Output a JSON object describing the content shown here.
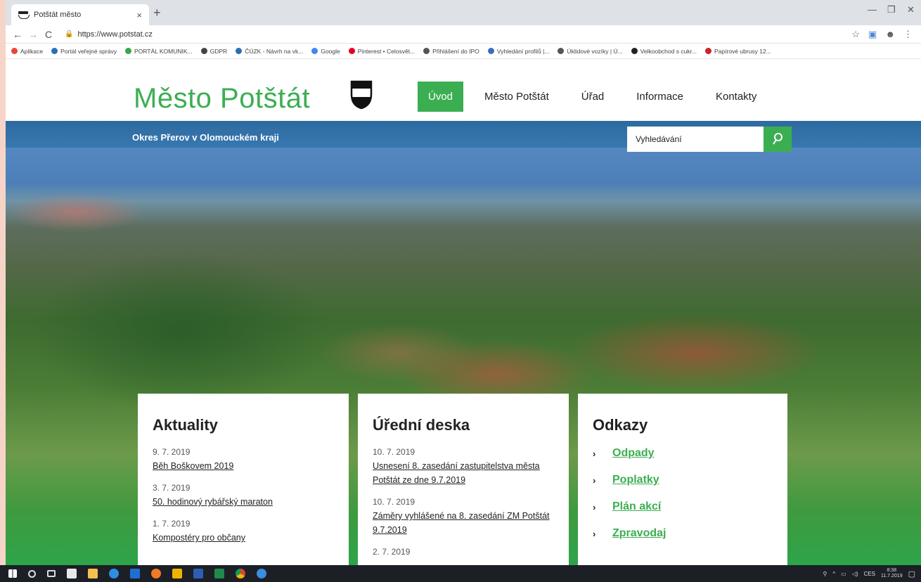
{
  "browser": {
    "tab_title": "Potštát město",
    "tab_close": "×",
    "new_tab": "+",
    "url": "https://www.potstat.cz",
    "bookmarks": [
      {
        "label": "Aplikace",
        "color": "#e5463a"
      },
      {
        "label": "Portál veřejné správy",
        "color": "#2a6fb5"
      },
      {
        "label": "PORTÁL KOMUNIK...",
        "color": "#3aa64c"
      },
      {
        "label": "GDPR",
        "color": "#444444"
      },
      {
        "label": "ČÚZK - Návrh na vk...",
        "color": "#2a6fb5"
      },
      {
        "label": "Google",
        "color": "#4285f4"
      },
      {
        "label": "Pinterest • Celosvět...",
        "color": "#e60023"
      },
      {
        "label": "Přihlášení do IPO",
        "color": "#555555"
      },
      {
        "label": "Vyhledání profilů |...",
        "color": "#3a6fc0"
      },
      {
        "label": "Úklidové vozíky | Ú...",
        "color": "#555555"
      },
      {
        "label": "Velkoobchod s cukr...",
        "color": "#222222"
      },
      {
        "label": "Papírové ubrusy 12...",
        "color": "#d0202a"
      }
    ]
  },
  "site": {
    "logo_text": "Město Potštát",
    "nav": [
      {
        "label": "Úvod",
        "active": true
      },
      {
        "label": "Město Potštát",
        "active": false
      },
      {
        "label": "Úřad",
        "active": false
      },
      {
        "label": "Informace",
        "active": false
      },
      {
        "label": "Kontakty",
        "active": false
      }
    ],
    "subtitle": "Okres Přerov v Olomouckém kraji",
    "search_placeholder": "Vyhledávání",
    "accent_color": "#3cae52"
  },
  "aktuality": {
    "title": "Aktuality",
    "items": [
      {
        "date": "9. 7. 2019",
        "text": "Běh Boškovem 2019"
      },
      {
        "date": "3. 7. 2019",
        "text": "50. hodinový rybářský maraton"
      },
      {
        "date": "1. 7. 2019",
        "text": "Kompostéry pro občany"
      }
    ]
  },
  "uredni_deska": {
    "title": "Úřední deska",
    "items": [
      {
        "date": "10. 7. 2019",
        "text": "Usnesení 8. zasedání zastupitelstva města Potštát ze dne 9.7.2019"
      },
      {
        "date": "10. 7. 2019",
        "text": "Záměry vyhlášené na 8. zasedání ZM Potštát 9.7.2019"
      },
      {
        "date": "2. 7. 2019",
        "text": ""
      }
    ]
  },
  "odkazy": {
    "title": "Odkazy",
    "items": [
      "Odpady",
      "Poplatky",
      "Plán akcí",
      "Zpravodaj"
    ]
  },
  "taskbar": {
    "lang": "CES",
    "time": "8:38",
    "date": "11.7.2019"
  }
}
